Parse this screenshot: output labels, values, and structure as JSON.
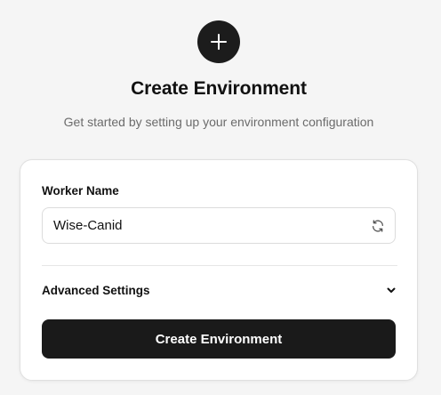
{
  "header": {
    "icon": "plus-icon",
    "title": "Create Environment",
    "subtitle": "Get started by setting up your environment configuration"
  },
  "form": {
    "worker_name_label": "Worker Name",
    "worker_name_value": "Wise-Canid",
    "refresh_icon": "refresh-icon",
    "advanced_settings_label": "Advanced Settings",
    "advanced_settings_icon": "chevron-down-icon",
    "submit_label": "Create Environment"
  },
  "colors": {
    "background": "#f5f5f5",
    "card": "#ffffff",
    "primary": "#1a1a1a",
    "muted_text": "#6b6b6b"
  }
}
